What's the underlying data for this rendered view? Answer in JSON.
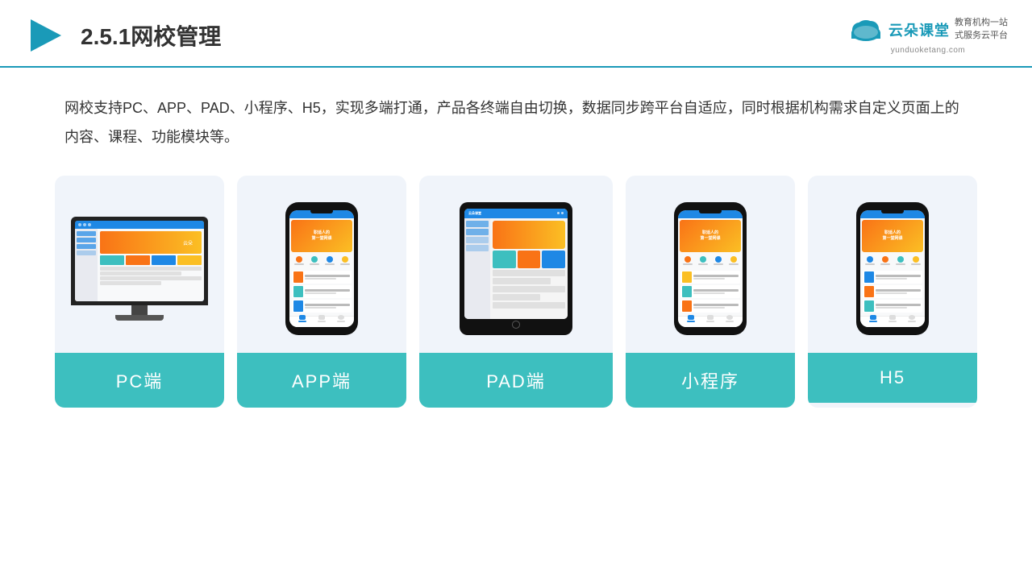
{
  "header": {
    "title": "2.5.1网校管理",
    "brand_name": "云朵课堂",
    "brand_url": "yunduoketang.com",
    "brand_tagline_line1": "教育机构一站",
    "brand_tagline_line2": "式服务云平台"
  },
  "description": {
    "text": "网校支持PC、APP、PAD、小程序、H5，实现多端打通，产品各终端自由切换，数据同步跨平台自适应，同时根据机构需求自定义页面上的内容、课程、功能模块等。"
  },
  "cards": [
    {
      "id": "pc",
      "label": "PC端"
    },
    {
      "id": "app",
      "label": "APP端"
    },
    {
      "id": "pad",
      "label": "PAD端"
    },
    {
      "id": "mini",
      "label": "小程序"
    },
    {
      "id": "h5",
      "label": "H5"
    }
  ],
  "colors": {
    "teal": "#3dbfbf",
    "blue_accent": "#1a9ab8",
    "header_border": "#1a9ab8"
  }
}
